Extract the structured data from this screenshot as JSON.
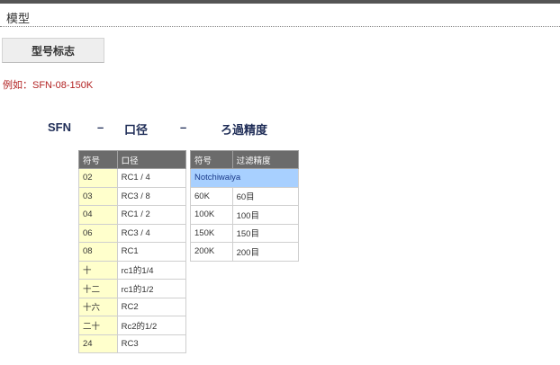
{
  "section": {
    "title": "模型"
  },
  "tab": {
    "label": "型号标志"
  },
  "example": "例如：SFN-08-150K",
  "formula": {
    "prefix": "SFN",
    "dash1": "–",
    "part1": "口径",
    "dash2": "–",
    "part2": "ろ過精度"
  },
  "bore_table": {
    "headers": [
      "符号",
      "口径"
    ],
    "rows": [
      [
        "02",
        "RC1 / 4"
      ],
      [
        "03",
        "RC3 / 8"
      ],
      [
        "04",
        "RC1 / 2"
      ],
      [
        "06",
        "RC3 / 4"
      ],
      [
        "08",
        "RC1"
      ],
      [
        "十",
        "rc1的1/4"
      ],
      [
        "十二",
        "rc1的1/2"
      ],
      [
        "十六",
        "RC2"
      ],
      [
        "二十",
        "Rc2的1/2"
      ],
      [
        "24",
        "RC3"
      ]
    ]
  },
  "filter_table": {
    "headers": [
      "符号",
      "过滤精度"
    ],
    "brand": "Notchiwaiya",
    "rows": [
      [
        "60K",
        "60目"
      ],
      [
        "100K",
        "100目"
      ],
      [
        "150K",
        "150目"
      ],
      [
        "200K",
        "200目"
      ]
    ]
  },
  "colors": {
    "header_bg": "#6b6b6b",
    "code_cell_bg": "#ffffcc",
    "brand_row_bg": "#a8d0ff",
    "example_text": "#b22222",
    "formula_text": "#1f2d57"
  }
}
